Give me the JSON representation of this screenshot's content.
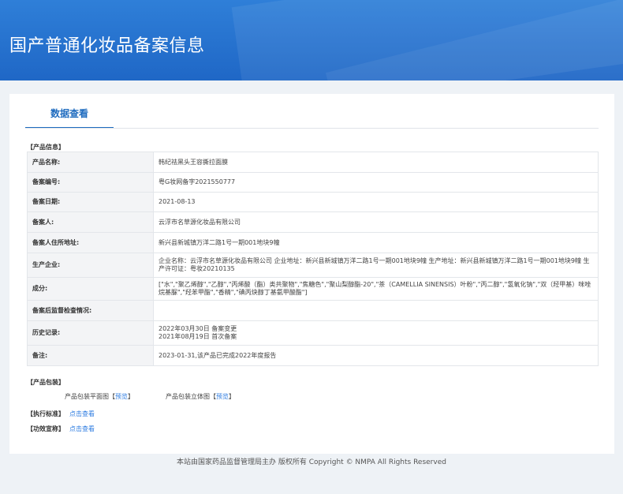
{
  "header": {
    "title": "国产普通化妆品备案信息"
  },
  "tab": {
    "label": "数据查看"
  },
  "sections": {
    "product_info": "【产品信息】",
    "product_pack": "【产品包装】",
    "standard": "【执行标准】",
    "efficacy": "【功效宣称】"
  },
  "rows": [
    {
      "label": "产品名称:",
      "value": "韩纪祛黑头王容撕拉面膜"
    },
    {
      "label": "备案编号:",
      "value": "粤G妆网备字2021550777"
    },
    {
      "label": "备案日期:",
      "value": "2021-08-13"
    },
    {
      "label": "备案人:",
      "value": "云浮市名草源化妆品有限公司"
    },
    {
      "label": "备案人住所地址:",
      "value": "新兴县新城镇万洋二路1号一期001地块9幢"
    },
    {
      "label": "生产企业:",
      "value": "企业名称：云浮市名草源化妆品有限公司 企业地址：新兴县新城镇万洋二路1号一期001地块9幢 生产地址：新兴县新城镇万洋二路1号一期001地块9幢 生产许可证：粤妆20210135"
    },
    {
      "label": "成分:",
      "value": "[\"水\",\"聚乙烯醇\",\"乙醇\",\"丙烯酸（酯）类共聚物\",\"焦糖色\",\"聚山梨醇酯-20\",\"茶（CAMELLIA SINENSIS）叶粉\",\"丙二醇\",\"氢氧化钠\",\"双（羟甲基）咪唑烷基脲\",\"羟苯甲酯\",\"香精\",\"碘丙炔醇丁基氨甲酸酯\"]"
    },
    {
      "label": "备案后监督检查情况:",
      "value": ""
    },
    {
      "label": "历史记录:",
      "value": "2022年03月30日 备案变更",
      "value2": "2021年08月19日 首次备案"
    },
    {
      "label": "备注:",
      "value": "2023-01-31,该产品已完成2022年度报告"
    }
  ],
  "packaging": {
    "flat_label": "产品包装平面图",
    "solid_label": "产品包装立体图",
    "preview_label": "预览"
  },
  "links": {
    "view": "点击查看"
  },
  "footer": {
    "text": "本站由国家药品监督管理局主办 版权所有 Copyright © NMPA All Rights Reserved"
  }
}
